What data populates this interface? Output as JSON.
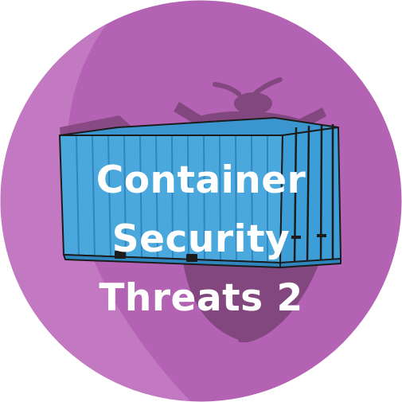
{
  "badge": {
    "title_lines": [
      "Container",
      "Security",
      "Threats 2"
    ],
    "icons": {
      "container": "shipping-container-icon",
      "bug": "bug-icon"
    },
    "colors": {
      "background": "#b462b3",
      "background_light": "#c67dc4",
      "bug_shadow": "#83477f",
      "container_fill": "#4ba8dd",
      "container_dark": "#2f86be",
      "outline": "#1c1c1c",
      "text": "#ffffff"
    }
  }
}
